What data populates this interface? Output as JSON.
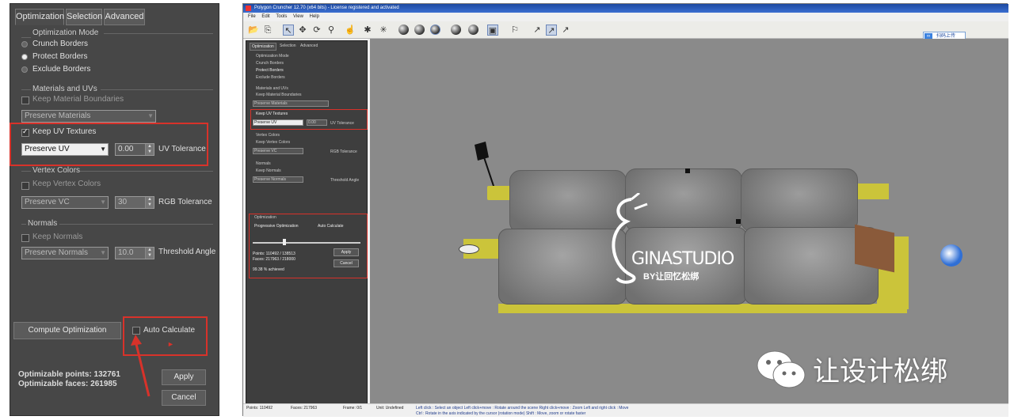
{
  "left_panel": {
    "tabs": [
      "Optimization",
      "Selection",
      "Advanced"
    ],
    "optimization_mode": {
      "title": "Optimization Mode",
      "options": [
        "Crunch Borders",
        "Protect Borders",
        "Exclude Borders"
      ],
      "selected": "Protect Borders"
    },
    "materials": {
      "title": "Materials and UVs",
      "keep_material_boundaries": "Keep Material Boundaries",
      "preserve_materials": "Preserve Materials",
      "keep_uv_textures": "Keep UV Textures",
      "preserve_uv": "Preserve UV",
      "uv_value": "0.00",
      "uv_tolerance": "UV Tolerance"
    },
    "vertex_colors": {
      "title": "Vertex Colors",
      "keep": "Keep Vertex Colors",
      "preserve": "Preserve VC",
      "value": "30",
      "tolerance": "RGB Tolerance"
    },
    "normals": {
      "title": "Normals",
      "keep": "Keep Normals",
      "preserve": "Preserve Normals",
      "value": "10.0",
      "threshold": "Threshold Angle"
    },
    "compute_button": "Compute Optimization",
    "auto_calculate": "Auto Calculate",
    "optimizable_points": "Optimizable points: 132761",
    "optimizable_faces": "Optimizable faces: 261985",
    "apply": "Apply",
    "cancel": "Cancel"
  },
  "app": {
    "title": "Polygon Cruncher 12.70 (x64 bits) - License registered and activated",
    "menu": [
      "File",
      "Edit",
      "Tools",
      "View",
      "Help"
    ],
    "top_right_button": "扫码上传",
    "side": {
      "tabs": [
        "Optimization",
        "Selection",
        "Advanced"
      ],
      "optimization_mode": "Optimization Mode",
      "modes": [
        "Crunch Borders",
        "Protect Borders",
        "Exclude Borders"
      ],
      "materials": "Materials and UVs",
      "keep_material_boundaries": "Keep Material Boundaries",
      "preserve_materials": "Preserve Materials",
      "keep_uv_textures": "Keep UV Textures",
      "preserve_uv": "Preserve UV",
      "uv_value": "0.00",
      "uv_tolerance": "UV Tolerance",
      "vertex_colors": "Vertex Colors",
      "keep_vertex_colors": "Keep Vertex Colors",
      "preserve_vc": "Preserve VC",
      "rgb_tolerance": "RGB Tolerance",
      "normals": "Normals",
      "keep_normals": "Keep Normals",
      "preserve_normals": "Preserve Normals",
      "threshold_angle": "Threshold Angle",
      "optimization": "Optimization",
      "progressive": "Progressive Optimization",
      "auto_calculate": "Auto Calculate",
      "points": "Points: 110492 / 138513",
      "faces": "Faces: 217963 / 218000",
      "achieved": "99.38 % achieved",
      "apply": "Apply",
      "cancel": "Cancel"
    },
    "status": {
      "points": "Points: 110492",
      "faces": "Faces: 217963",
      "frame": "Frame: 0/1",
      "unit": "Unit: Undefined",
      "hint1": "Left click : Select an object   Left click+move : Rotate around the scene   Right click+move : Zoom   Left and right click : Move",
      "hint2": "Ctrl : Rotate in the axis indicated by the cursor (rotation mode)   Shift : Move, zoom or rotate faster"
    }
  },
  "watermark": {
    "brand": "GINASTUDIO",
    "sub": "BY让回忆松绑",
    "wechat": "让设计松绑"
  },
  "colors": {
    "highlight": "#d8322a",
    "panel": "#474747",
    "sofa_base": "#cbc43a"
  }
}
